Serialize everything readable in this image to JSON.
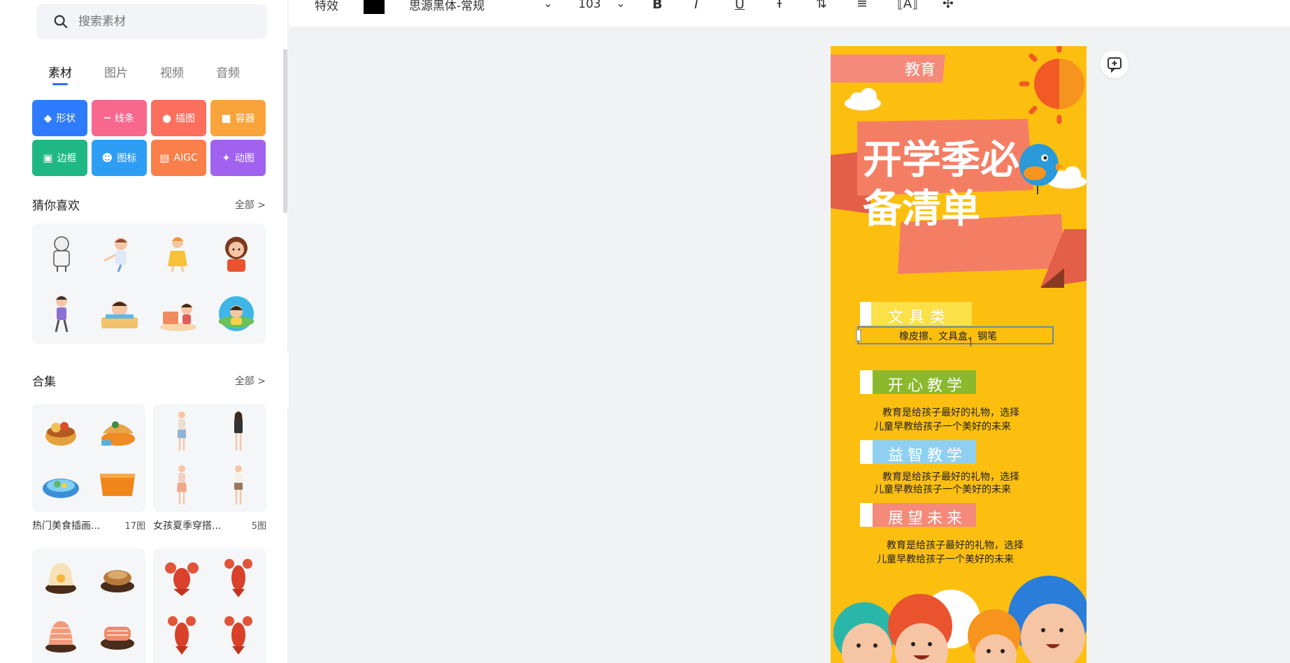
{
  "search": {
    "placeholder": "搜索素材"
  },
  "tabs": [
    {
      "label": "素材",
      "active": true
    },
    {
      "label": "图片",
      "active": false
    },
    {
      "label": "视频",
      "active": false
    },
    {
      "label": "音频",
      "active": false
    }
  ],
  "categories": [
    {
      "label": "形状",
      "icon": "shape-icon",
      "color": "#2f7bff"
    },
    {
      "label": "线条",
      "icon": "line-icon",
      "color": "#f7678e"
    },
    {
      "label": "插图",
      "icon": "palette-icon",
      "color": "#fb6f5c"
    },
    {
      "label": "容器",
      "icon": "box-icon",
      "color": "#f9a33b"
    },
    {
      "label": "边框",
      "icon": "frame-icon",
      "color": "#1fb784"
    },
    {
      "label": "图标",
      "icon": "emoji-icon",
      "color": "#2e9ef5"
    },
    {
      "label": "AIGC",
      "icon": "ai-icon",
      "color": "#fb7f4a"
    },
    {
      "label": "动图",
      "icon": "sparkle-icon",
      "color": "#a262f0"
    }
  ],
  "guess": {
    "title": "猜你喜欢",
    "more": "全部 >"
  },
  "collection": {
    "title": "合集",
    "more": "全部 >"
  },
  "collections": [
    {
      "name": "热门美食插画...",
      "count": "17图"
    },
    {
      "name": "女孩夏季穿搭...",
      "count": "5图"
    }
  ],
  "toolbar": {
    "effects": "特效",
    "font": "思源黑体-常规",
    "font_size": "103",
    "bold": "B",
    "italic": "I",
    "underline": "U"
  },
  "poster": {
    "tag": "教育",
    "title_line1": "开学季必",
    "title_line2": "备清单",
    "sections": [
      {
        "heading": "文具类",
        "body_line1": "橡皮擦、文具盒、钢笔",
        "body_line2": ""
      },
      {
        "heading": "开心教学",
        "body_line1": "教育是给孩子最好的礼物，选择",
        "body_line2": "儿童早教给孩子一个美好的未来"
      },
      {
        "heading": "益智教学",
        "body_line1": "教育是给孩子最好的礼物，选择",
        "body_line2": "儿童早教给孩子一个美好的未来"
      },
      {
        "heading": "展望未来",
        "body_line1": "教育是给孩子最好的礼物，选择",
        "body_line2": "儿童早教给孩子一个美好的未来"
      }
    ],
    "colors": {
      "background": "#fdbf0f",
      "ribbon": "#f47e64",
      "green_tag": "#8ab92d",
      "blue_tag": "#8fd0f0",
      "salmon_tag": "#f58a7a"
    }
  }
}
